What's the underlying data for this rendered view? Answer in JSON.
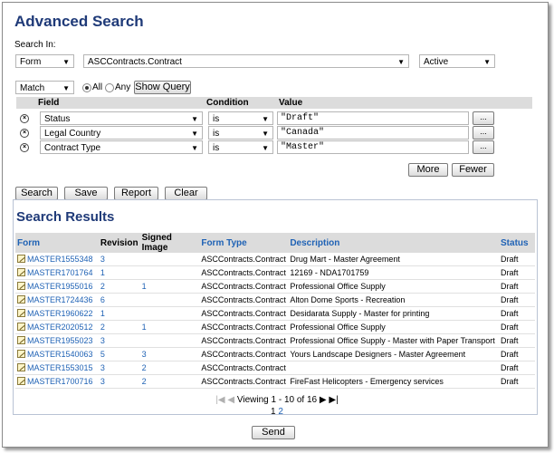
{
  "page": {
    "title": "Advanced Search"
  },
  "search_in": {
    "label": "Search In:",
    "scope": "Form",
    "form_type": "ASCContracts.Contract",
    "status": "Active"
  },
  "match": {
    "mode": "Match",
    "all_label": "All",
    "any_label": "Any",
    "selected": "All",
    "show_query_label": "Show Query"
  },
  "criteria": {
    "headers": {
      "field": "Field",
      "condition": "Condition",
      "value": "Value"
    },
    "rows": [
      {
        "field": "Status",
        "condition": "is",
        "value": "\"Draft\"",
        "browse": "..."
      },
      {
        "field": "Legal Country",
        "condition": "is",
        "value": "\"Canada\"",
        "browse": "..."
      },
      {
        "field": "Contract Type",
        "condition": "is",
        "value": "\"Master\"",
        "browse": "..."
      }
    ],
    "more_label": "More",
    "fewer_label": "Fewer"
  },
  "actions": {
    "search": "Search",
    "save": "Save",
    "report": "Report",
    "clear": "Clear"
  },
  "results": {
    "title": "Search Results",
    "columns": [
      "Form",
      "Revision",
      "Signed Image",
      "Form Type",
      "Description",
      "Status"
    ],
    "rows": [
      {
        "form": "MASTER1555348",
        "revision": "3",
        "signed": "",
        "type": "ASCContracts.Contract",
        "description": "Drug Mart - Master Agreement",
        "status": "Draft"
      },
      {
        "form": "MASTER1701764",
        "revision": "1",
        "signed": "",
        "type": "ASCContracts.Contract",
        "description": "12169 - NDA1701759",
        "status": "Draft"
      },
      {
        "form": "MASTER1955016",
        "revision": "2",
        "signed": "1",
        "type": "ASCContracts.Contract",
        "description": "Professional Office Supply",
        "status": "Draft"
      },
      {
        "form": "MASTER1724436",
        "revision": "6",
        "signed": "",
        "type": "ASCContracts.Contract",
        "description": "Alton Dome Sports - Recreation",
        "status": "Draft"
      },
      {
        "form": "MASTER1960622",
        "revision": "1",
        "signed": "",
        "type": "ASCContracts.Contract",
        "description": "Desidarata Supply - Master for printing",
        "status": "Draft"
      },
      {
        "form": "MASTER2020512",
        "revision": "2",
        "signed": "1",
        "type": "ASCContracts.Contract",
        "description": "Professional Office Supply",
        "status": "Draft"
      },
      {
        "form": "MASTER1955023",
        "revision": "3",
        "signed": "",
        "type": "ASCContracts.Contract",
        "description": "Professional Office Supply - Master with Paper Transport",
        "status": "Draft"
      },
      {
        "form": "MASTER1540063",
        "revision": "5",
        "signed": "3",
        "type": "ASCContracts.Contract",
        "description": "Yours Landscape Designers - Master Agreement",
        "status": "Draft"
      },
      {
        "form": "MASTER1553015",
        "revision": "3",
        "signed": "2",
        "type": "ASCContracts.Contract",
        "description": "",
        "status": "Draft"
      },
      {
        "form": "MASTER1700716",
        "revision": "3",
        "signed": "2",
        "type": "ASCContracts.Contract",
        "description": "FireFast Helicopters - Emergency services",
        "status": "Draft"
      }
    ],
    "pager": {
      "viewing": "Viewing 1 - 10 of 16",
      "page1": "1",
      "page2": "2"
    },
    "send_label": "Send"
  },
  "icons": {
    "row": "edit-form-icon",
    "remove": "remove-criterion-icon",
    "first": "first-page-icon",
    "prev": "prev-page-icon",
    "next": "next-page-icon",
    "last": "last-page-icon"
  },
  "colors": {
    "heading": "#1f3a78",
    "link": "#1f62b5",
    "header_bg": "#dcdcdc"
  }
}
